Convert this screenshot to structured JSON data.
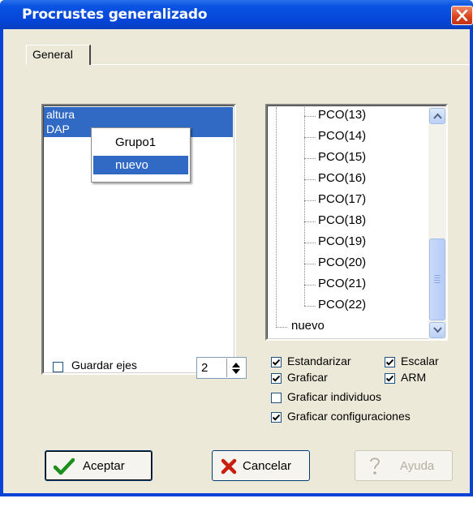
{
  "window": {
    "title": "Procrustes generalizado"
  },
  "tabs": [
    {
      "label": "General"
    }
  ],
  "variables_list": {
    "items": [
      "altura",
      "DAP"
    ]
  },
  "context_menu": {
    "items": [
      "Grupo1",
      "nuevo"
    ],
    "highlighted_index": 1
  },
  "tree": {
    "children": [
      "PCO(13)",
      "PCO(14)",
      "PCO(15)",
      "PCO(16)",
      "PCO(17)",
      "PCO(18)",
      "PCO(19)",
      "PCO(20)",
      "PCO(21)",
      "PCO(22)"
    ],
    "sibling": "nuevo"
  },
  "options": {
    "guardar_ejes": {
      "label": "Guardar ejes",
      "checked": false
    },
    "num_ejes": "2",
    "estandarizar": {
      "label": "Estandarizar",
      "checked": true
    },
    "escalar": {
      "label": "Escalar",
      "checked": true
    },
    "graficar": {
      "label": "Graficar",
      "checked": true
    },
    "arm": {
      "label": "ARM",
      "checked": true
    },
    "graficar_individuos": {
      "label": "Graficar individuos",
      "checked": false
    },
    "graficar_configuraciones": {
      "label": "Graficar configuraciones",
      "checked": true
    }
  },
  "buttons": {
    "accept": "Aceptar",
    "cancel": "Cancelar",
    "help": "Ayuda"
  },
  "colors": {
    "selection": "#316ac5",
    "titlebar": "#0546d8",
    "dialog": "#ece9d8"
  }
}
